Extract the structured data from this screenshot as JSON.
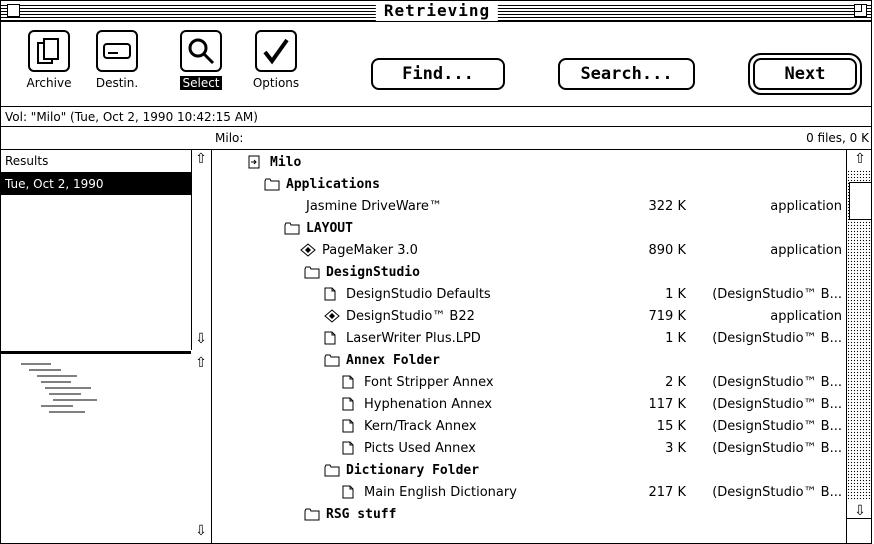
{
  "window": {
    "title": "Retrieving"
  },
  "toolbar": {
    "tools": [
      {
        "label": "Archive",
        "icon": "archive-icon"
      },
      {
        "label": "Destin.",
        "icon": "destination-icon"
      },
      {
        "label": "Select",
        "icon": "magnifier-icon"
      },
      {
        "label": "Options",
        "icon": "checkmark-icon"
      }
    ],
    "find_label": "Find...",
    "search_label": "Search...",
    "next_label": "Next"
  },
  "volume_line": "Vol: \"Milo\"  (Tue, Oct 2, 1990  10:42:15 AM)",
  "path": {
    "name": "Milo:",
    "count": "0 files, 0 K"
  },
  "results": {
    "header": "Results",
    "items": [
      "Tue, Oct 2, 1990"
    ]
  },
  "list": [
    {
      "name": "Milo",
      "type": "volume",
      "size": "",
      "kind": ""
    },
    {
      "name": "Applications",
      "type": "folder",
      "size": "",
      "kind": ""
    },
    {
      "name": "Jasmine DriveWare™",
      "type": "none",
      "size": "322 K",
      "kind": "application"
    },
    {
      "name": "LAYOUT",
      "type": "folder",
      "size": "",
      "kind": ""
    },
    {
      "name": "PageMaker 3.0",
      "type": "app",
      "size": "890 K",
      "kind": "application"
    },
    {
      "name": "DesignStudio",
      "type": "folder",
      "size": "",
      "kind": ""
    },
    {
      "name": "DesignStudio Defaults",
      "type": "doc",
      "size": "1 K",
      "kind": "(DesignStudio™ B..."
    },
    {
      "name": "DesignStudio™ B22",
      "type": "app",
      "size": "719 K",
      "kind": "application"
    },
    {
      "name": "LaserWriter Plus.LPD",
      "type": "doc",
      "size": "1 K",
      "kind": "(DesignStudio™ B..."
    },
    {
      "name": "Annex Folder",
      "type": "folder",
      "size": "",
      "kind": ""
    },
    {
      "name": "Font Stripper Annex",
      "type": "doc",
      "size": "2 K",
      "kind": "(DesignStudio™ B..."
    },
    {
      "name": "Hyphenation Annex",
      "type": "doc",
      "size": "117 K",
      "kind": "(DesignStudio™ B..."
    },
    {
      "name": "Kern/Track Annex",
      "type": "doc",
      "size": "15 K",
      "kind": "(DesignStudio™ B..."
    },
    {
      "name": "Picts Used Annex",
      "type": "doc",
      "size": "3 K",
      "kind": "(DesignStudio™ B..."
    },
    {
      "name": "Dictionary Folder",
      "type": "folder",
      "size": "",
      "kind": ""
    },
    {
      "name": "Main English Dictionary",
      "type": "doc",
      "size": "217 K",
      "kind": "(DesignStudio™ B..."
    },
    {
      "name": "RSG stuff",
      "type": "folder",
      "size": "",
      "kind": ""
    }
  ]
}
